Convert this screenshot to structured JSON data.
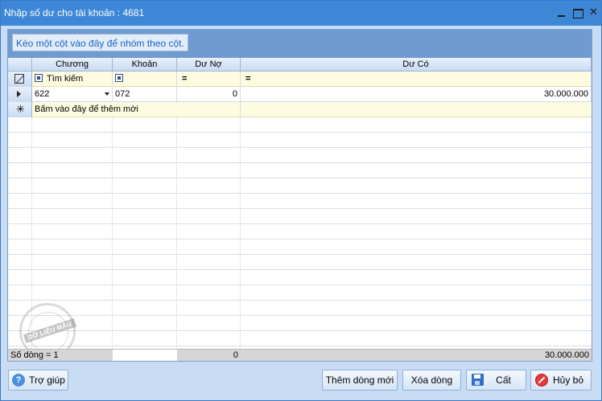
{
  "window": {
    "title": "Nhập số dư cho tài khoản : 4681",
    "close_glyph": "✕"
  },
  "grid": {
    "group_hint": "Kéo một cột vào đây để nhóm theo cột.",
    "columns": {
      "chuong": "Chương",
      "khoan": "Khoản",
      "du_no": "Dư Nợ",
      "du_co": "Dư Có"
    },
    "filter_row": {
      "chuong_text": "Tìm kiếm",
      "du_no_op": "=",
      "du_co_op": "="
    },
    "rows": [
      {
        "chuong": "622",
        "khoan": "072",
        "du_no": "0",
        "du_co": "30.000.000"
      }
    ],
    "new_row_hint": "Bấm vào đây để thêm mới",
    "new_row_glyph": "✳",
    "footer": {
      "count": "Số dòng = 1",
      "du_no_total": "0",
      "du_co_total": "30.000.000"
    },
    "watermark": "DỮ LIỆU MẪU"
  },
  "buttons": {
    "help": "Trợ giúp",
    "help_glyph": "?",
    "add_row": "Thêm dòng mới",
    "delete_row": "Xóa dòng",
    "save": "Cất",
    "cancel": "Hủy bỏ"
  },
  "icons": {
    "help": "help-icon",
    "save": "save-icon",
    "cancel": "cancel-icon"
  },
  "colors": {
    "title_bar": "#3d87d6",
    "group_panel": "#6f9bce",
    "filter_row": "#fefce0"
  }
}
